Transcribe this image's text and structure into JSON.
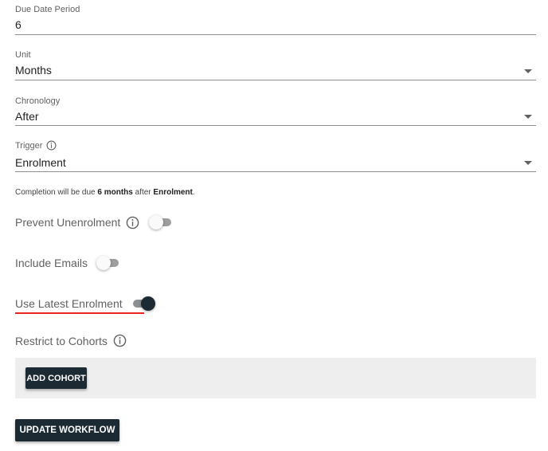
{
  "form": {
    "due_date_period": {
      "label": "Due Date Period",
      "value": "6"
    },
    "unit": {
      "label": "Unit",
      "value": "Months"
    },
    "chronology": {
      "label": "Chronology",
      "value": "After"
    },
    "trigger": {
      "label": "Trigger",
      "value": "Enrolment"
    }
  },
  "summary": {
    "prefix": "Completion will be due ",
    "period": "6 months",
    "middle": " after ",
    "trigger": "Enrolment",
    "suffix": "."
  },
  "toggles": {
    "prevent_unenrolment": {
      "label": "Prevent Unenrolment",
      "checked": false
    },
    "include_emails": {
      "label": "Include Emails",
      "checked": false
    },
    "use_latest_enrolment": {
      "label": "Use Latest Enrolment",
      "checked": true
    }
  },
  "restrict_to_cohorts": {
    "label": "Restrict to Cohorts",
    "add_button": "ADD COHORT"
  },
  "update_button": "UPDATE WORKFLOW",
  "colors": {
    "primary_dark": "#1c2a33",
    "highlight_red": "#e8261d",
    "panel_grey": "#eeeeee"
  },
  "icons": {
    "info": "info-circle-icon",
    "dropdown": "caret-down-icon"
  }
}
